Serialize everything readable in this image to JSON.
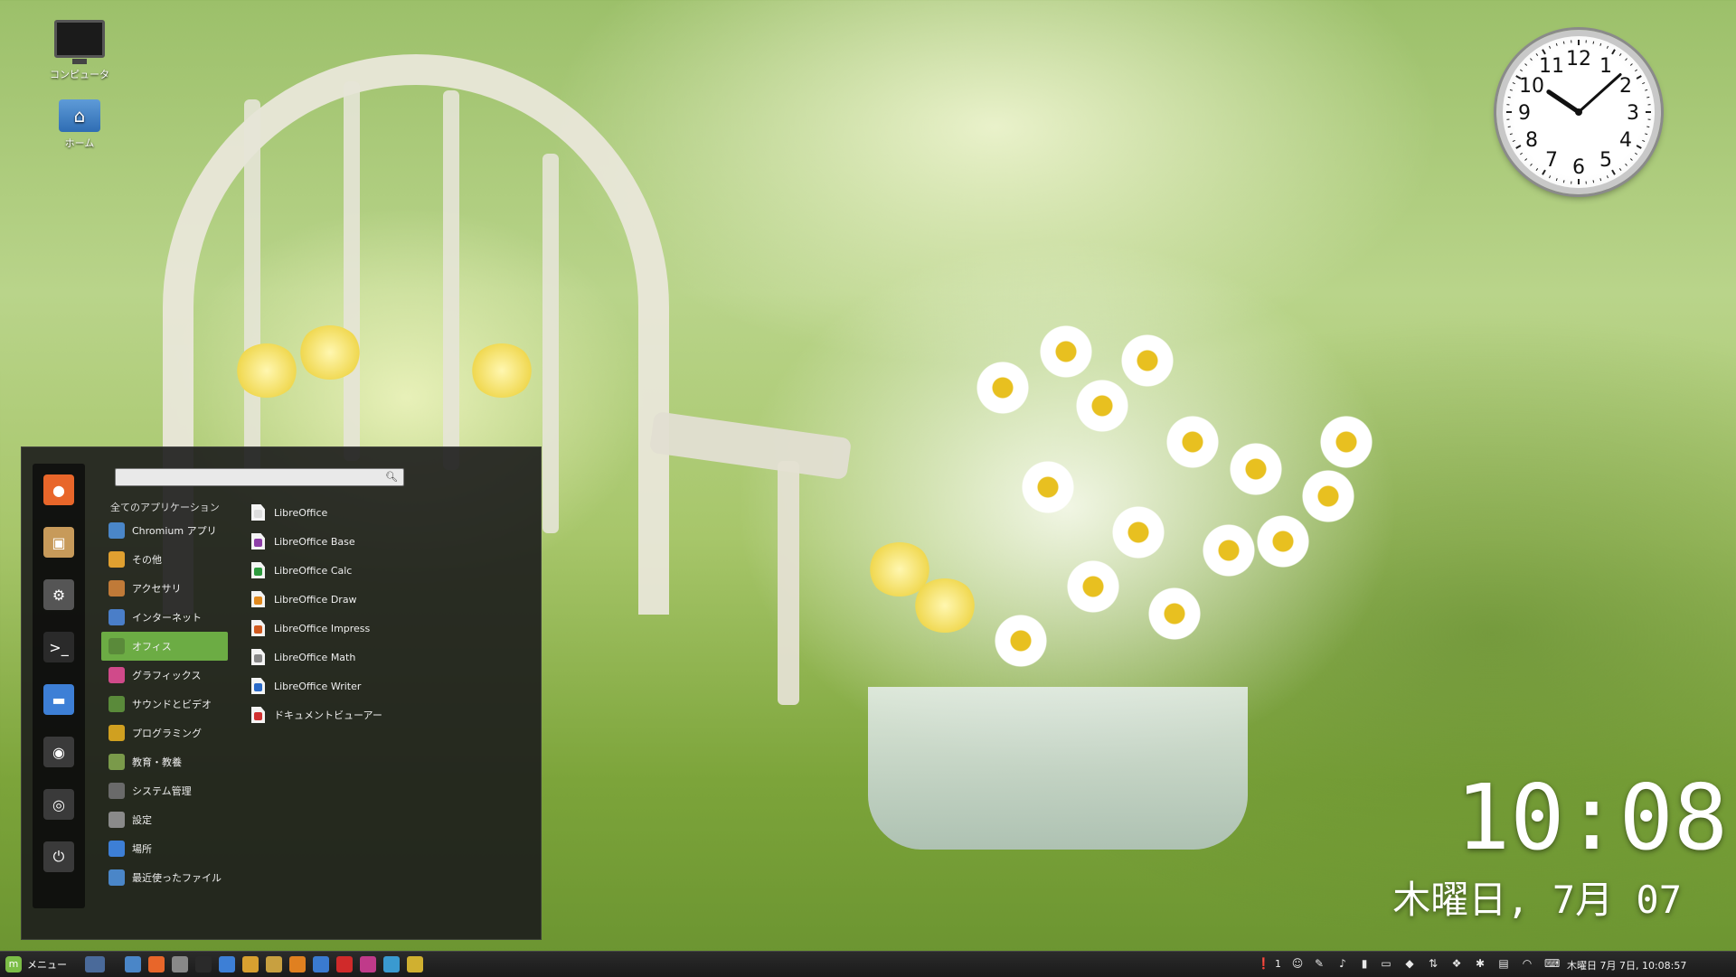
{
  "desktop": {
    "icons": [
      {
        "label": "コンピュータ",
        "icon": "computer-icon"
      },
      {
        "label": "ホーム",
        "icon": "home-folder-icon"
      }
    ]
  },
  "desklets": {
    "analog_clock": {
      "hour": 10,
      "minute": 8,
      "numbers": [
        "12",
        "1",
        "2",
        "3",
        "4",
        "5",
        "6",
        "7",
        "8",
        "9",
        "10",
        "11"
      ]
    },
    "digital_clock": {
      "time": "10:08",
      "date": "木曜日, 7月 07"
    }
  },
  "menu": {
    "search_placeholder": "",
    "all_apps_label": "全てのアプリケーション",
    "favorites": [
      {
        "name": "firefox",
        "color": "#e8662a"
      },
      {
        "name": "software-manager",
        "color": "#c79a5a"
      },
      {
        "name": "system-settings",
        "color": "#555555"
      },
      {
        "name": "terminal",
        "color": "#2a2a2a"
      },
      {
        "name": "files",
        "color": "#3d7fd6"
      },
      {
        "name": "lock-screen",
        "color": "#3a3a3a"
      },
      {
        "name": "logout",
        "color": "#3a3a3a"
      },
      {
        "name": "shutdown",
        "color": "#3a3a3a"
      }
    ],
    "categories": [
      {
        "label": "Chromium アプリ",
        "color": "#4a86c8"
      },
      {
        "label": "その他",
        "color": "#e0a030"
      },
      {
        "label": "アクセサリ",
        "color": "#c07a38"
      },
      {
        "label": "インターネット",
        "color": "#4a7ec8"
      },
      {
        "label": "オフィス",
        "color": "#5a8a3a",
        "active": true
      },
      {
        "label": "グラフィックス",
        "color": "#d04a8a"
      },
      {
        "label": "サウンドとビデオ",
        "color": "#5a8a3a"
      },
      {
        "label": "プログラミング",
        "color": "#d0a020"
      },
      {
        "label": "教育・教養",
        "color": "#7a9a4a"
      },
      {
        "label": "システム管理",
        "color": "#6a6a6a"
      },
      {
        "label": "設定",
        "color": "#8a8a8a"
      },
      {
        "label": "場所",
        "color": "#3d7fd6"
      },
      {
        "label": "最近使ったファイル",
        "color": "#4a86c8"
      }
    ],
    "apps": [
      {
        "label": "LibreOffice",
        "color": "#dddddd"
      },
      {
        "label": "LibreOffice Base",
        "color": "#8e3fa8"
      },
      {
        "label": "LibreOffice Calc",
        "color": "#2e9a3e"
      },
      {
        "label": "LibreOffice Draw",
        "color": "#e08a20"
      },
      {
        "label": "LibreOffice Impress",
        "color": "#d05a20"
      },
      {
        "label": "LibreOffice Math",
        "color": "#888888"
      },
      {
        "label": "LibreOffice Writer",
        "color": "#2a6ac8"
      },
      {
        "label": "ドキュメントビューアー",
        "color": "#d03030"
      }
    ]
  },
  "taskbar": {
    "menu_label": "メニュー",
    "workspace_count": "1",
    "clock": "木曜日 7月 7日, 10:08:57",
    "launchers": [
      {
        "name": "show-desktop",
        "color": "#4a6a9a"
      },
      {
        "name": "chromium",
        "color": "#4a86c8"
      },
      {
        "name": "firefox",
        "color": "#e8662a"
      },
      {
        "name": "system-monitor",
        "color": "#888888"
      },
      {
        "name": "terminal",
        "color": "#2a2a2a"
      },
      {
        "name": "files",
        "color": "#3d7fd6"
      },
      {
        "name": "text-editor",
        "color": "#d8a030"
      },
      {
        "name": "image-viewer",
        "color": "#c8a040"
      },
      {
        "name": "package-manager",
        "color": "#e08020"
      },
      {
        "name": "mint-update",
        "color": "#3a7ad0"
      },
      {
        "name": "media-player",
        "color": "#d02a2a"
      },
      {
        "name": "graphics-app",
        "color": "#c03a8a"
      },
      {
        "name": "screenshot",
        "color": "#3a9ad0"
      },
      {
        "name": "extra-app",
        "color": "#d0b030"
      }
    ],
    "tray": [
      "info-icon",
      "user-icon",
      "pen-icon",
      "volume-icon",
      "battery-icon",
      "display-icon",
      "shield-icon",
      "network-icon",
      "dropbox-icon",
      "bluetooth-icon",
      "folder-icon",
      "wifi-icon",
      "keyboard-icon"
    ]
  }
}
